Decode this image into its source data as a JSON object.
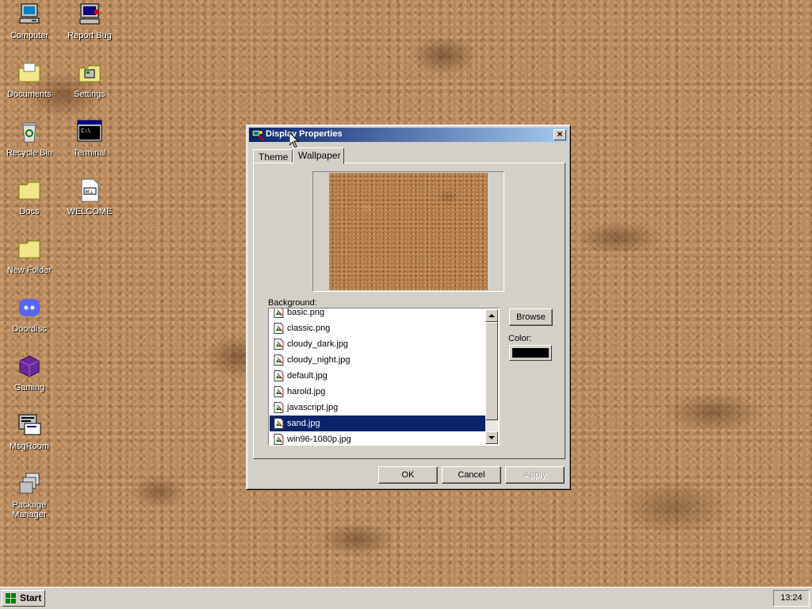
{
  "desktop": {
    "icons": [
      {
        "label": "Computer",
        "icon": "computer-icon"
      },
      {
        "label": "Report Bug",
        "icon": "report-bug-icon"
      },
      {
        "label": "Documents",
        "icon": "documents-folder-icon"
      },
      {
        "label": "Settings",
        "icon": "settings-folder-icon"
      },
      {
        "label": "Recycle Bin",
        "icon": "recycle-bin-icon"
      },
      {
        "label": "Terminal",
        "icon": "terminal-icon"
      },
      {
        "label": "Docs",
        "icon": "folder-icon"
      },
      {
        "label": "WELCOME",
        "icon": "markdown-file-icon"
      },
      {
        "label": "New Folder",
        "icon": "folder-icon"
      },
      {
        "label": "Doordisc",
        "icon": "discord-icon"
      },
      {
        "label": "Gaming",
        "icon": "gaming-cube-icon"
      },
      {
        "label": "MsgRoom",
        "icon": "msgroom-icon"
      },
      {
        "label": "Package Manager",
        "icon": "package-manager-icon"
      }
    ]
  },
  "window": {
    "title": "Display Properties",
    "tabs": [
      {
        "label": "Theme",
        "active": false
      },
      {
        "label": "Wallpaper",
        "active": true
      }
    ],
    "background_label": "Background:",
    "files": [
      {
        "name": "basic.png",
        "selected": false
      },
      {
        "name": "classic.png",
        "selected": false
      },
      {
        "name": "cloudy_dark.jpg",
        "selected": false
      },
      {
        "name": "cloudy_night.jpg",
        "selected": false
      },
      {
        "name": "default.jpg",
        "selected": false
      },
      {
        "name": "harold.jpg",
        "selected": false
      },
      {
        "name": "javascript.jpg",
        "selected": false
      },
      {
        "name": "sand.jpg",
        "selected": true
      },
      {
        "name": "win96-1080p.jpg",
        "selected": false
      }
    ],
    "browse_label": "Browse",
    "color_label": "Color:",
    "color_value": "#000000",
    "ok_label": "OK",
    "cancel_label": "Cancel",
    "apply_label": "Apply"
  },
  "taskbar": {
    "start_label": "Start",
    "clock": "13:24"
  },
  "colors": {
    "title_active_start": "#0a246a",
    "title_active_end": "#a6caf0",
    "selection": "#0a246a",
    "face": "#d4d0c8"
  }
}
